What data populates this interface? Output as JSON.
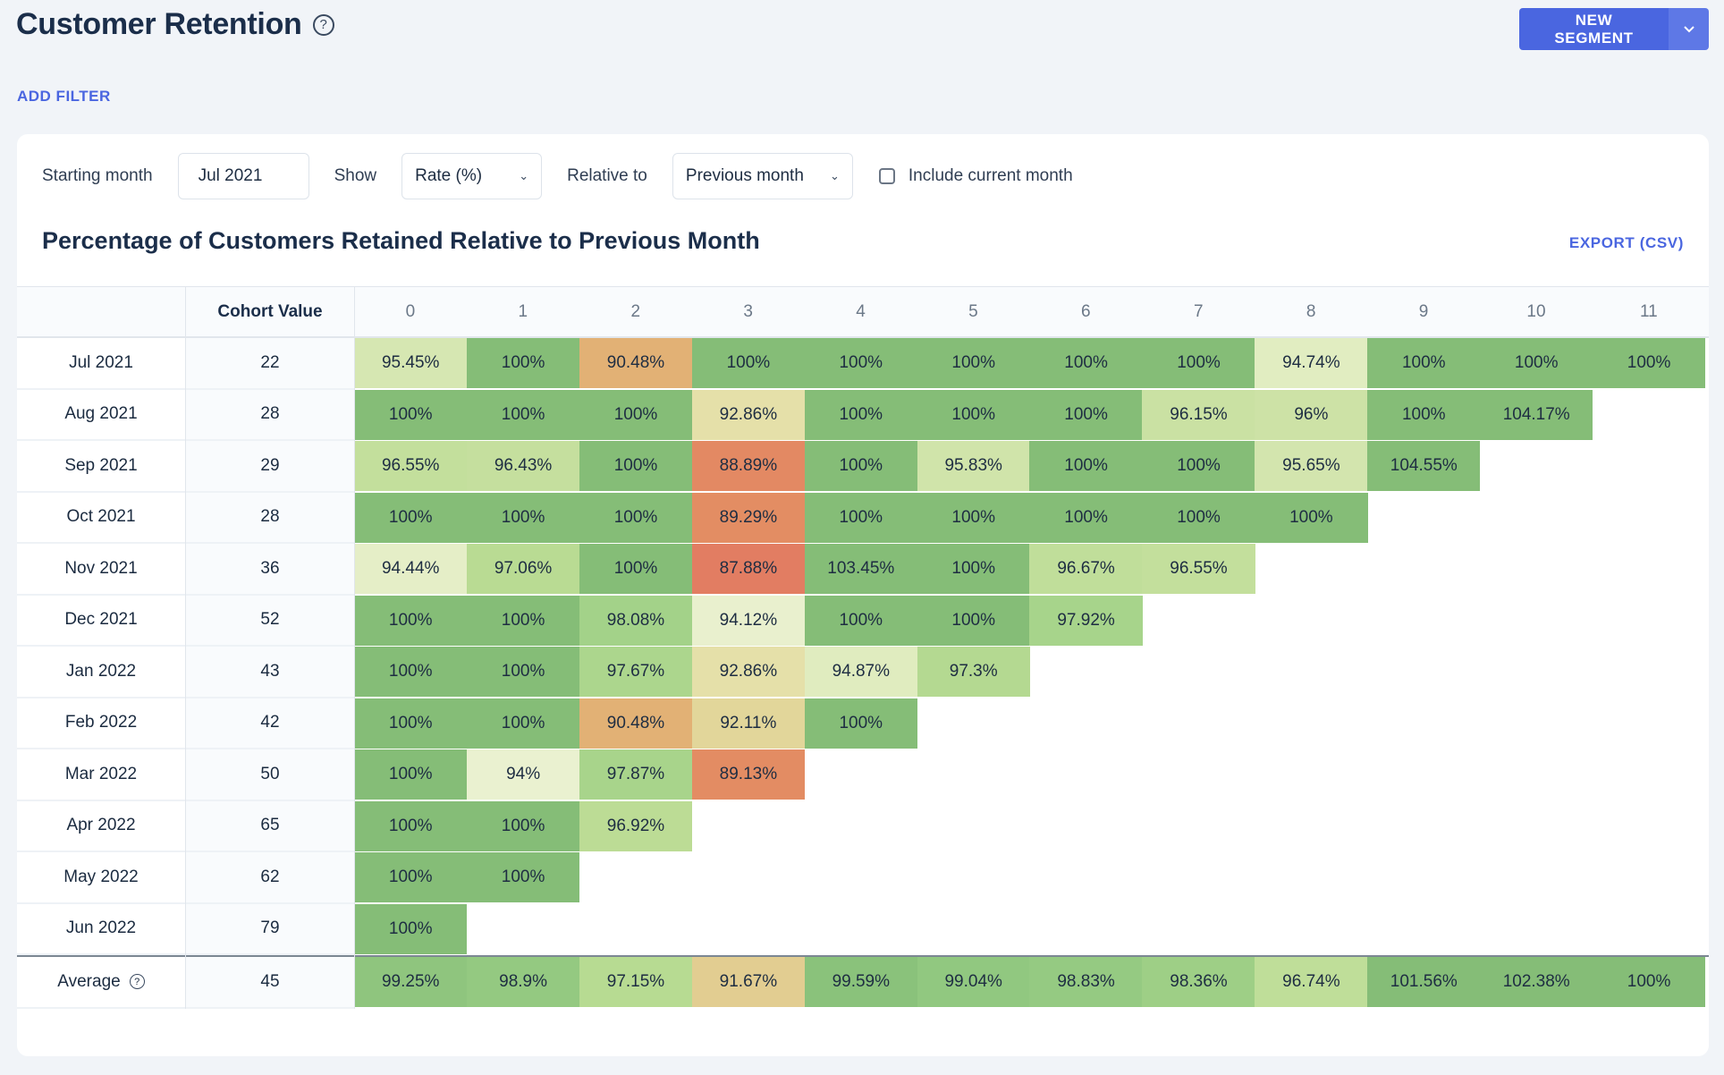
{
  "header": {
    "title": "Customer Retention",
    "help_icon": "question-circle-icon",
    "new_segment_label": "NEW SEGMENT",
    "dropdown_icon": "chevron-down-icon",
    "add_filter_label": "ADD FILTER"
  },
  "controls": {
    "starting_month_label": "Starting month",
    "starting_month_value": "Jul 2021",
    "show_label": "Show",
    "show_value": "Rate (%)",
    "relative_label": "Relative to",
    "relative_value": "Previous month",
    "include_current_label": "Include current month",
    "include_current_checked": false
  },
  "section": {
    "title": "Percentage of Customers Retained Relative to Previous Month",
    "export_label": "EXPORT (CSV)"
  },
  "colors": {
    "accent": "#4a66e0",
    "scale_high": "#85bd77",
    "scale_mid": "#e8f1cc",
    "scale_low": "#e27a62"
  },
  "chart_data": {
    "type": "heatmap",
    "title": "Percentage of Customers Retained Relative to Previous Month",
    "cohort_header": "Cohort Value",
    "columns": [
      "0",
      "1",
      "2",
      "3",
      "4",
      "5",
      "6",
      "7",
      "8",
      "9",
      "10",
      "11"
    ],
    "rows": [
      {
        "label": "Jul 2021",
        "cohort": "22",
        "values": [
          "95.45%",
          "100%",
          "90.48%",
          "100%",
          "100%",
          "100%",
          "100%",
          "100%",
          "94.74%",
          "100%",
          "100%",
          "100%"
        ]
      },
      {
        "label": "Aug 2021",
        "cohort": "28",
        "values": [
          "100%",
          "100%",
          "100%",
          "92.86%",
          "100%",
          "100%",
          "100%",
          "96.15%",
          "96%",
          "100%",
          "104.17%"
        ]
      },
      {
        "label": "Sep 2021",
        "cohort": "29",
        "values": [
          "96.55%",
          "96.43%",
          "100%",
          "88.89%",
          "100%",
          "95.83%",
          "100%",
          "100%",
          "95.65%",
          "104.55%"
        ]
      },
      {
        "label": "Oct 2021",
        "cohort": "28",
        "values": [
          "100%",
          "100%",
          "100%",
          "89.29%",
          "100%",
          "100%",
          "100%",
          "100%",
          "100%"
        ]
      },
      {
        "label": "Nov 2021",
        "cohort": "36",
        "values": [
          "94.44%",
          "97.06%",
          "100%",
          "87.88%",
          "103.45%",
          "100%",
          "96.67%",
          "96.55%"
        ]
      },
      {
        "label": "Dec 2021",
        "cohort": "52",
        "values": [
          "100%",
          "100%",
          "98.08%",
          "94.12%",
          "100%",
          "100%",
          "97.92%"
        ]
      },
      {
        "label": "Jan 2022",
        "cohort": "43",
        "values": [
          "100%",
          "100%",
          "97.67%",
          "92.86%",
          "94.87%",
          "97.3%"
        ]
      },
      {
        "label": "Feb 2022",
        "cohort": "42",
        "values": [
          "100%",
          "100%",
          "90.48%",
          "92.11%",
          "100%"
        ]
      },
      {
        "label": "Mar 2022",
        "cohort": "50",
        "values": [
          "100%",
          "94%",
          "97.87%",
          "89.13%"
        ]
      },
      {
        "label": "Apr 2022",
        "cohort": "65",
        "values": [
          "100%",
          "100%",
          "96.92%"
        ]
      },
      {
        "label": "May 2022",
        "cohort": "62",
        "values": [
          "100%",
          "100%"
        ]
      },
      {
        "label": "Jun 2022",
        "cohort": "79",
        "values": [
          "100%"
        ]
      }
    ],
    "average": {
      "label": "Average",
      "cohort": "45",
      "values": [
        "99.25%",
        "98.9%",
        "97.15%",
        "91.67%",
        "99.59%",
        "99.04%",
        "98.83%",
        "98.36%",
        "96.74%",
        "101.56%",
        "102.38%",
        "100%"
      ]
    }
  }
}
